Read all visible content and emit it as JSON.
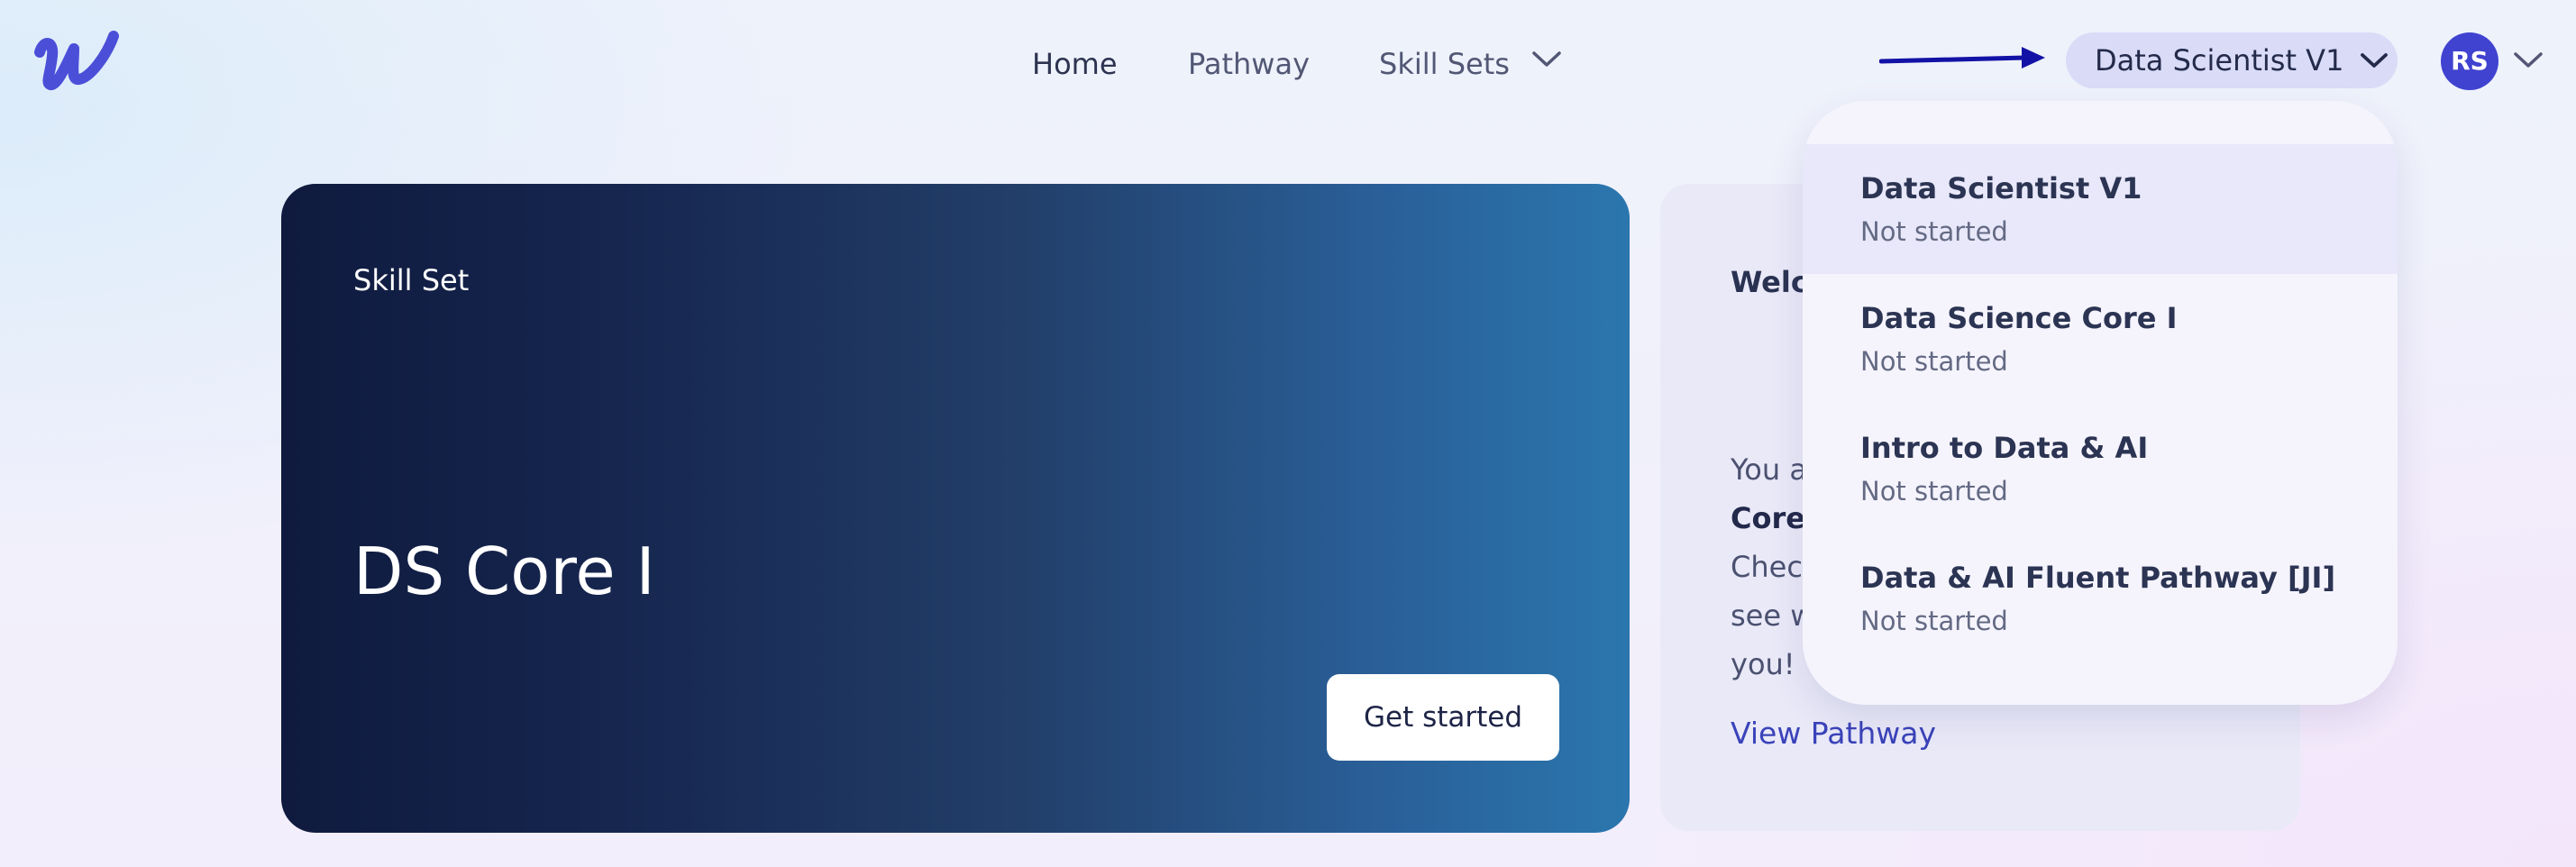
{
  "nav": {
    "home": "Home",
    "pathway": "Pathway",
    "skill_sets": "Skill Sets"
  },
  "skill_selector": {
    "label": "Data Scientist V1"
  },
  "user": {
    "initials": "RS"
  },
  "hero": {
    "eyebrow": "Skill Set",
    "title": "DS Core I",
    "cta": "Get started"
  },
  "welcome": {
    "title": "Welco",
    "line1": "You a",
    "line2": "Core",
    "line3": "Chec",
    "line4": "see w",
    "line5": "you!",
    "link": "View Pathway"
  },
  "dropdown": {
    "items": [
      {
        "name": "Data Scientist V1",
        "status": "Not started"
      },
      {
        "name": "Data Science Core I",
        "status": "Not started"
      },
      {
        "name": "Intro to Data & AI",
        "status": "Not started"
      },
      {
        "name": "Data & AI Fluent Pathway [JI]",
        "status": "Not started"
      }
    ]
  },
  "colors": {
    "accent": "#4043d0",
    "link": "#3a43b9",
    "pill": "#d9dbf7",
    "arrow": "#1212a6"
  }
}
